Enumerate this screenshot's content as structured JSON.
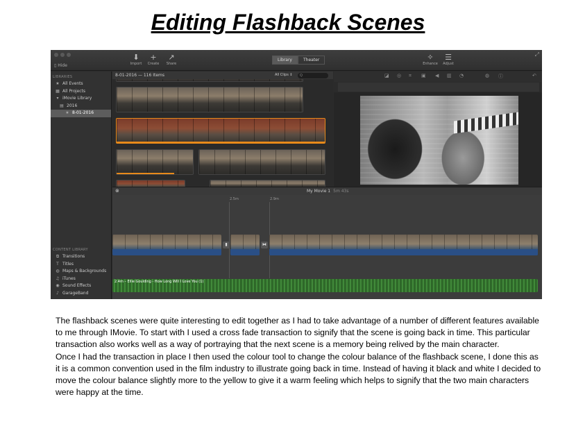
{
  "title": "Editing Flashback Scenes",
  "app": {
    "toolbar": {
      "hide_label": "Hide",
      "import_label": "Import",
      "create_label": "Create",
      "share_label": "Share",
      "tab_library": "Library",
      "tab_theater": "Theater",
      "enhance_label": "Enhance",
      "adjust_label": "Adjust"
    },
    "sidebar": {
      "libraries_header": "LIBRARIES",
      "items": [
        {
          "label": "All Events",
          "icon": "star-icon"
        },
        {
          "label": "All Projects",
          "icon": "film-icon"
        },
        {
          "label": "iMovie Library",
          "icon": "library-icon"
        },
        {
          "label": "2016",
          "icon": "folder-icon"
        },
        {
          "label": "8-01-2016",
          "icon": "event-icon"
        }
      ],
      "content_header": "CONTENT LIBRARY",
      "content_items": [
        {
          "label": "Transitions",
          "icon": "transitions-icon"
        },
        {
          "label": "Titles",
          "icon": "titles-icon"
        },
        {
          "label": "Maps & Backgrounds",
          "icon": "globe-icon"
        },
        {
          "label": "iTunes",
          "icon": "music-icon"
        },
        {
          "label": "Sound Effects",
          "icon": "speaker-icon"
        },
        {
          "label": "GarageBand",
          "icon": "guitar-icon"
        }
      ]
    },
    "browser": {
      "event_label": "8-01-2016 — 116 Items",
      "filter_label": "All Clips ⇕",
      "search_placeholder": "Q"
    },
    "timeline": {
      "project_title": "My Movie 1",
      "duration": "5m 43s",
      "ruler_marks": [
        "2.5m",
        "2.9m"
      ],
      "audio_label": "2.4m – Ellie Goulding - How Long Will I Love You (1)"
    }
  },
  "paragraphs": [
    "The flashback scenes were quite interesting to edit together as I had to take advantage of a number of different features available to me through IMovie. To start with I used a cross fade transaction to signify that the scene is going back in time. This particular transaction also works well as a way of portraying that the next scene is a memory being relived by the main character.",
    "Once I had the transaction in place I then used the colour tool to change the colour balance of the flashback scene, I done this as it is a common convention used in the film industry to illustrate going back in time. Instead of having it black and white I decided to move the colour balance slightly more to the yellow to give it a warm feeling which helps to signify that the two main characters were happy at the time."
  ]
}
